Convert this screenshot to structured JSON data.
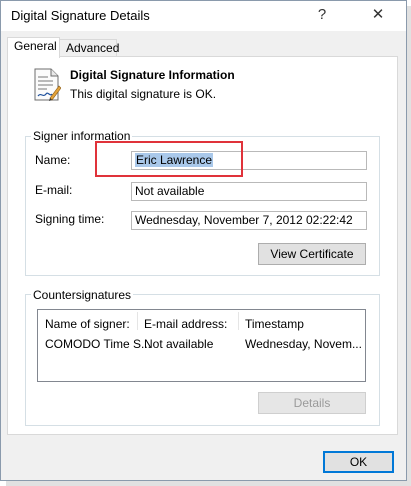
{
  "window": {
    "title": "Digital Signature Details",
    "help_label": "?",
    "close_label": "✕"
  },
  "tabs": [
    {
      "label": "General",
      "active": true
    },
    {
      "label": "Advanced",
      "active": false
    }
  ],
  "info": {
    "icon": "document-signature-icon",
    "title": "Digital Signature Information",
    "status": "This digital signature is OK."
  },
  "signer": {
    "group_label": "Signer information",
    "name_label": "Name:",
    "name_value": "Eric Lawrence",
    "email_label": "E-mail:",
    "email_value": "Not available",
    "signing_time_label": "Signing time:",
    "signing_time_value": "Wednesday, November 7, 2012 02:22:42",
    "view_certificate_label": "View Certificate"
  },
  "countersignatures": {
    "group_label": "Countersignatures",
    "columns": [
      "Name of signer:",
      "E-mail address:",
      "Timestamp"
    ],
    "rows": [
      [
        "COMODO Time S...",
        "Not available",
        "Wednesday, Novem..."
      ]
    ],
    "details_label": "Details"
  },
  "footer": {
    "ok_label": "OK"
  },
  "colors": {
    "highlight_box": "#e0323a",
    "selection": "#a9c8ea",
    "default_button_border": "#0078d7"
  }
}
